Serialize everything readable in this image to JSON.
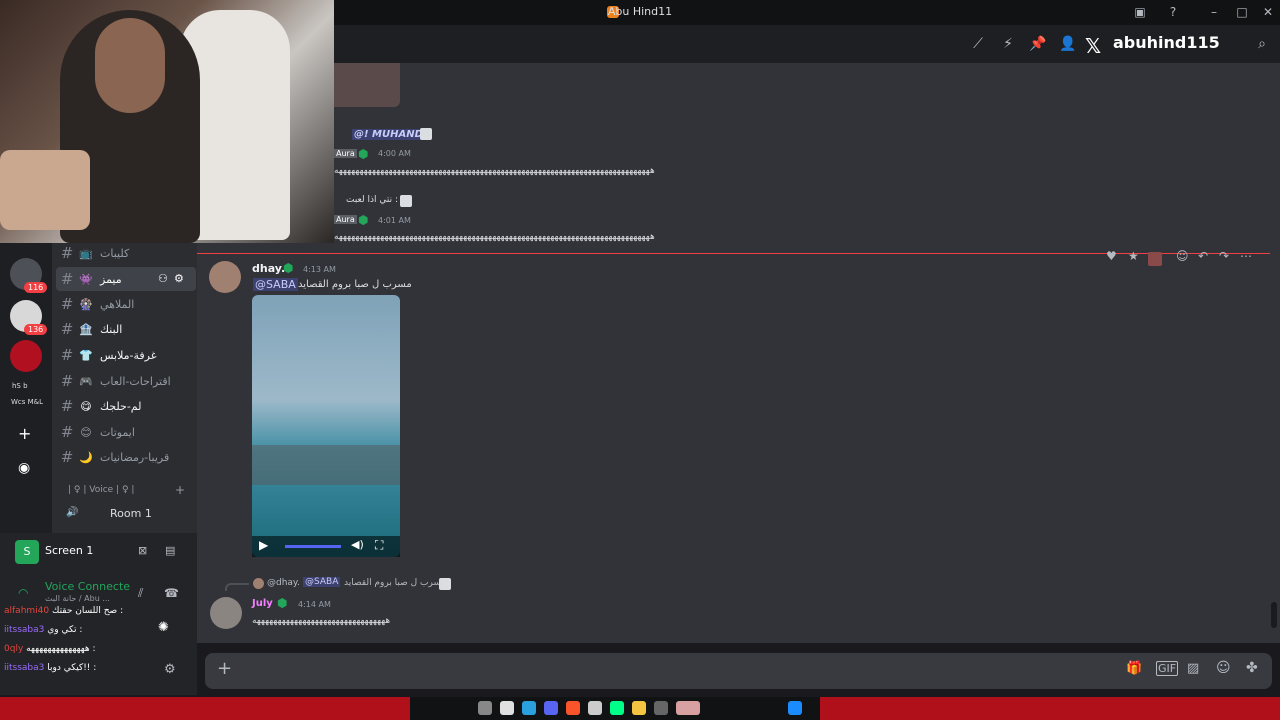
{
  "window": {
    "title": "Abu Hind11"
  },
  "header": {
    "x_handle": "abuhind115",
    "search_placeholder": "Search"
  },
  "channels": [
    {
      "emoji": "📺",
      "name": "كليبات"
    },
    {
      "emoji": "👾",
      "name": "ميمز"
    },
    {
      "emoji": "🎡",
      "name": "الملاهي"
    },
    {
      "emoji": "🏦",
      "name": "البنك"
    },
    {
      "emoji": "👕",
      "name": "غرفة-ملابس"
    },
    {
      "emoji": "🎮",
      "name": "اقتراحات-العاب"
    },
    {
      "emoji": "😋",
      "name": "لم-حلجك"
    },
    {
      "emoji": "😊",
      "name": "ايموتات"
    },
    {
      "emoji": "🌙",
      "name": "قريبا-رمضانيات"
    }
  ],
  "voice_category": "| ♀ | Voice | ♀ |",
  "voice_room": "Room 1",
  "servers": {
    "badge1": "116",
    "badge2": "136",
    "wcs": "Wcs M&L"
  },
  "screen_share": {
    "label": "Screen 1"
  },
  "voice": {
    "status": "Voice Connecte",
    "sub": "حانة البث / Abu ..."
  },
  "stream_chat": [
    {
      "user": "alfahmi40",
      "text": "صح اللسان حقتك :",
      "color": "#e2463c"
    },
    {
      "user": "iitssaba3",
      "text": "تكي وي :",
      "color": "#9b6bff"
    },
    {
      "user": "0qly",
      "text": "ههههههههههههههه :",
      "color": "#e2463c"
    },
    {
      "user": "iitssaba3",
      "text": "كيكي دوبا!! :",
      "color": "#9b6bff"
    }
  ],
  "upper_messages": [
    {
      "reply_user": "@! MUHAND",
      "user": "Aura",
      "time": "4:00 AM",
      "text": "ههههههههههههههههههههههههههههههههههههههههههههههههههههههههههههههههههههههههههههه"
    },
    {
      "reply_user": "نتي اذا لعبت :",
      "user": "Aura",
      "time": "4:01 AM",
      "text": "ههههههههههههههههههههههههههههههههههههههههههههههههههههههههههههههههههههههههههههه"
    }
  ],
  "main_message": {
    "user": "dhay.",
    "time": "4:13 AM",
    "mention": "@SABA",
    "text": "مسرب ل صبا بروم القصايد"
  },
  "reply_message": {
    "reply_user": "@dhay.",
    "reply_mention": "@SABA",
    "reply_text": "مسرب ل صبا بروم القصايد",
    "user": "July",
    "time": "4:14 AM",
    "text": "ههههههههههههههههههههههههههههههههه"
  },
  "colors": {
    "accent": "#5865f2",
    "online": "#23a55a",
    "mention": "#c9cdfb",
    "danger": "#f23f43"
  }
}
